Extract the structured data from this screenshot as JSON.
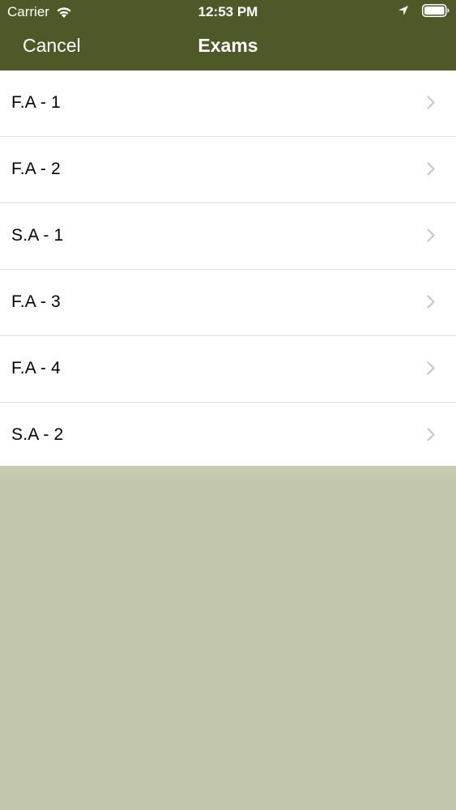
{
  "status_bar": {
    "carrier": "Carrier",
    "time": "12:53 PM",
    "icons": [
      "wifi-icon",
      "location-icon",
      "battery-icon"
    ]
  },
  "nav": {
    "cancel_label": "Cancel",
    "title": "Exams"
  },
  "exams": [
    {
      "label": "F.A - 1"
    },
    {
      "label": "F.A - 2"
    },
    {
      "label": "S.A - 1"
    },
    {
      "label": "F.A - 3"
    },
    {
      "label": "F.A - 4"
    },
    {
      "label": "S.A - 2"
    }
  ],
  "colors": {
    "nav_background": "#4d5a28",
    "page_background": "#c2c7ac",
    "row_background": "#ffffff",
    "separator": "#e1e1e3",
    "chevron": "#c4c4c7"
  }
}
